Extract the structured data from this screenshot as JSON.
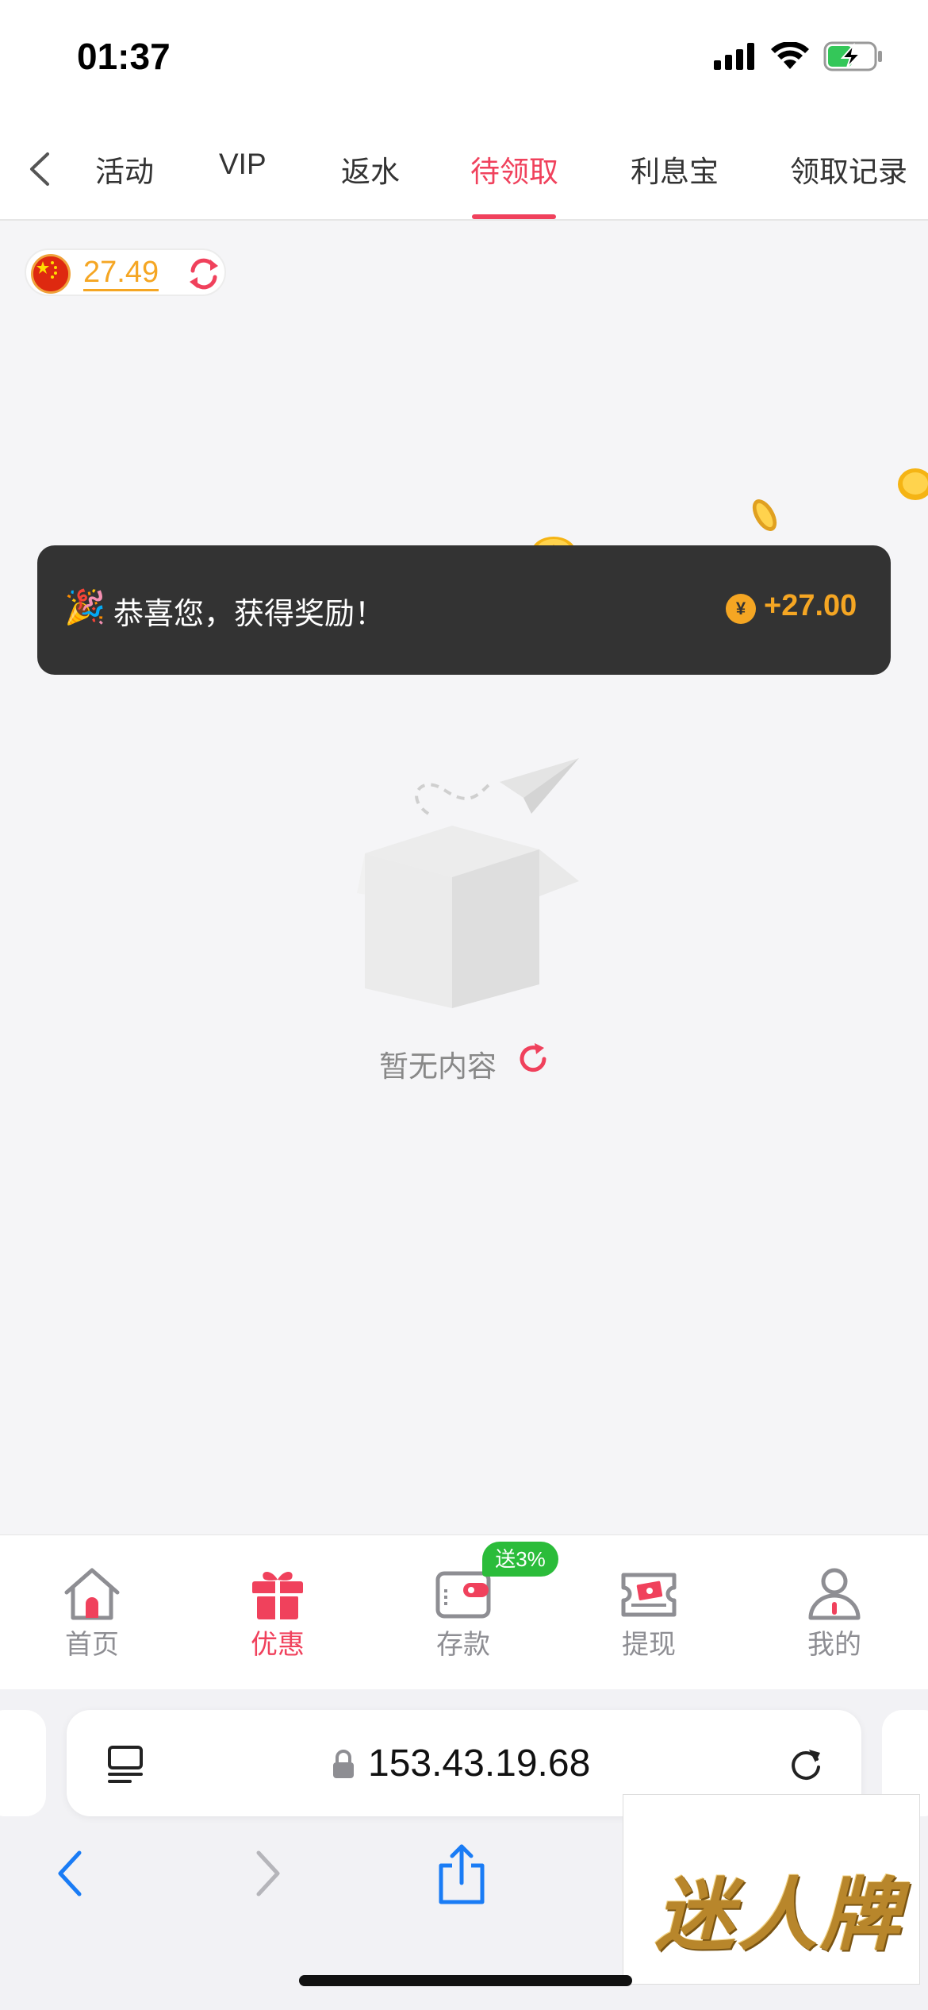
{
  "status_bar": {
    "time": "01:37"
  },
  "tabs": [
    {
      "label": "活动",
      "active": false
    },
    {
      "label": "VIP",
      "active": false
    },
    {
      "label": "返水",
      "active": false
    },
    {
      "label": "待领取",
      "active": true
    },
    {
      "label": "利息宝",
      "active": false
    },
    {
      "label": "领取记录",
      "active": false
    }
  ],
  "balance": {
    "value": "27.49",
    "flag": "china-flag-icon"
  },
  "toast": {
    "message": "恭喜您，获得奖励！",
    "currency_symbol": "¥",
    "amount": "+27.00"
  },
  "empty_state": {
    "text": "暂无内容"
  },
  "bottom_nav": {
    "items": [
      {
        "label": "首页",
        "icon": "home-icon",
        "active": false
      },
      {
        "label": "优惠",
        "icon": "gift-icon",
        "active": true
      },
      {
        "label": "存款",
        "icon": "wallet-icon",
        "active": false
      },
      {
        "label": "提现",
        "icon": "withdraw-icon",
        "active": false
      },
      {
        "label": "我的",
        "icon": "profile-icon",
        "active": false
      }
    ],
    "promo_badge": "送3%"
  },
  "browser": {
    "url": "153.43.19.68"
  },
  "watermark": {
    "text": "迷人牌"
  },
  "colors": {
    "accent": "#f0415c",
    "gold": "#f5a623",
    "toast_bg": "#333333",
    "badge_green": "#2bbc3a"
  }
}
